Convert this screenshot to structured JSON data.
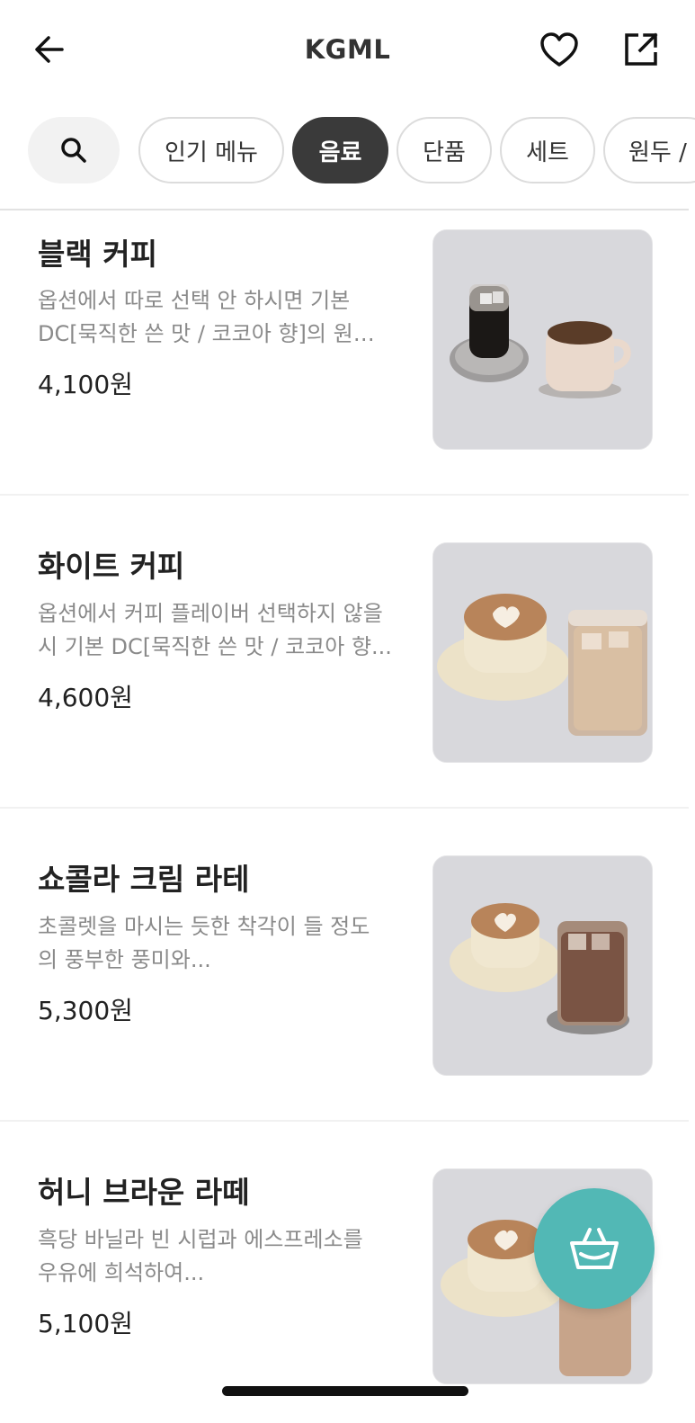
{
  "header": {
    "title": "KGML",
    "back_icon": "arrow-left-icon",
    "favorite_icon": "heart-icon",
    "share_icon": "share-icon"
  },
  "categories": {
    "search_icon": "search-icon",
    "items": [
      {
        "label": "인기 메뉴",
        "active": false
      },
      {
        "label": "음료",
        "active": true
      },
      {
        "label": "단품",
        "active": false
      },
      {
        "label": "세트",
        "active": false
      },
      {
        "label": "원두 /",
        "active": false
      }
    ]
  },
  "menu": [
    {
      "name": "블랙 커피",
      "desc_line1": "옵션에서 따로 선택 안 하시면 기본",
      "desc_line2": "DC[묵직한 쓴 맛 / 코코아 향]의 원…",
      "price": "4,100원"
    },
    {
      "name": "화이트 커피",
      "desc_line1": "옵션에서 커피 플레이버 선택하지 않을",
      "desc_line2": "시 기본 DC[묵직한 쓴 맛 / 코코아 향...",
      "price": "4,600원"
    },
    {
      "name": "쇼콜라 크림 라테",
      "desc_line1": "초콜렛을 마시는 듯한 착각이 들 정도",
      "desc_line2": "의 풍부한 풍미와...",
      "price": "5,300원"
    },
    {
      "name": "허니 브라운 라떼",
      "desc_line1": "흑당 바닐라 빈 시럽과 에스프레소를",
      "desc_line2": "우유에 희석하여...",
      "price": "5,100원"
    }
  ],
  "cart": {
    "icon": "shopping-basket-icon"
  },
  "colors": {
    "accent": "#52b8b5",
    "active_chip": "#3a3a3a"
  }
}
